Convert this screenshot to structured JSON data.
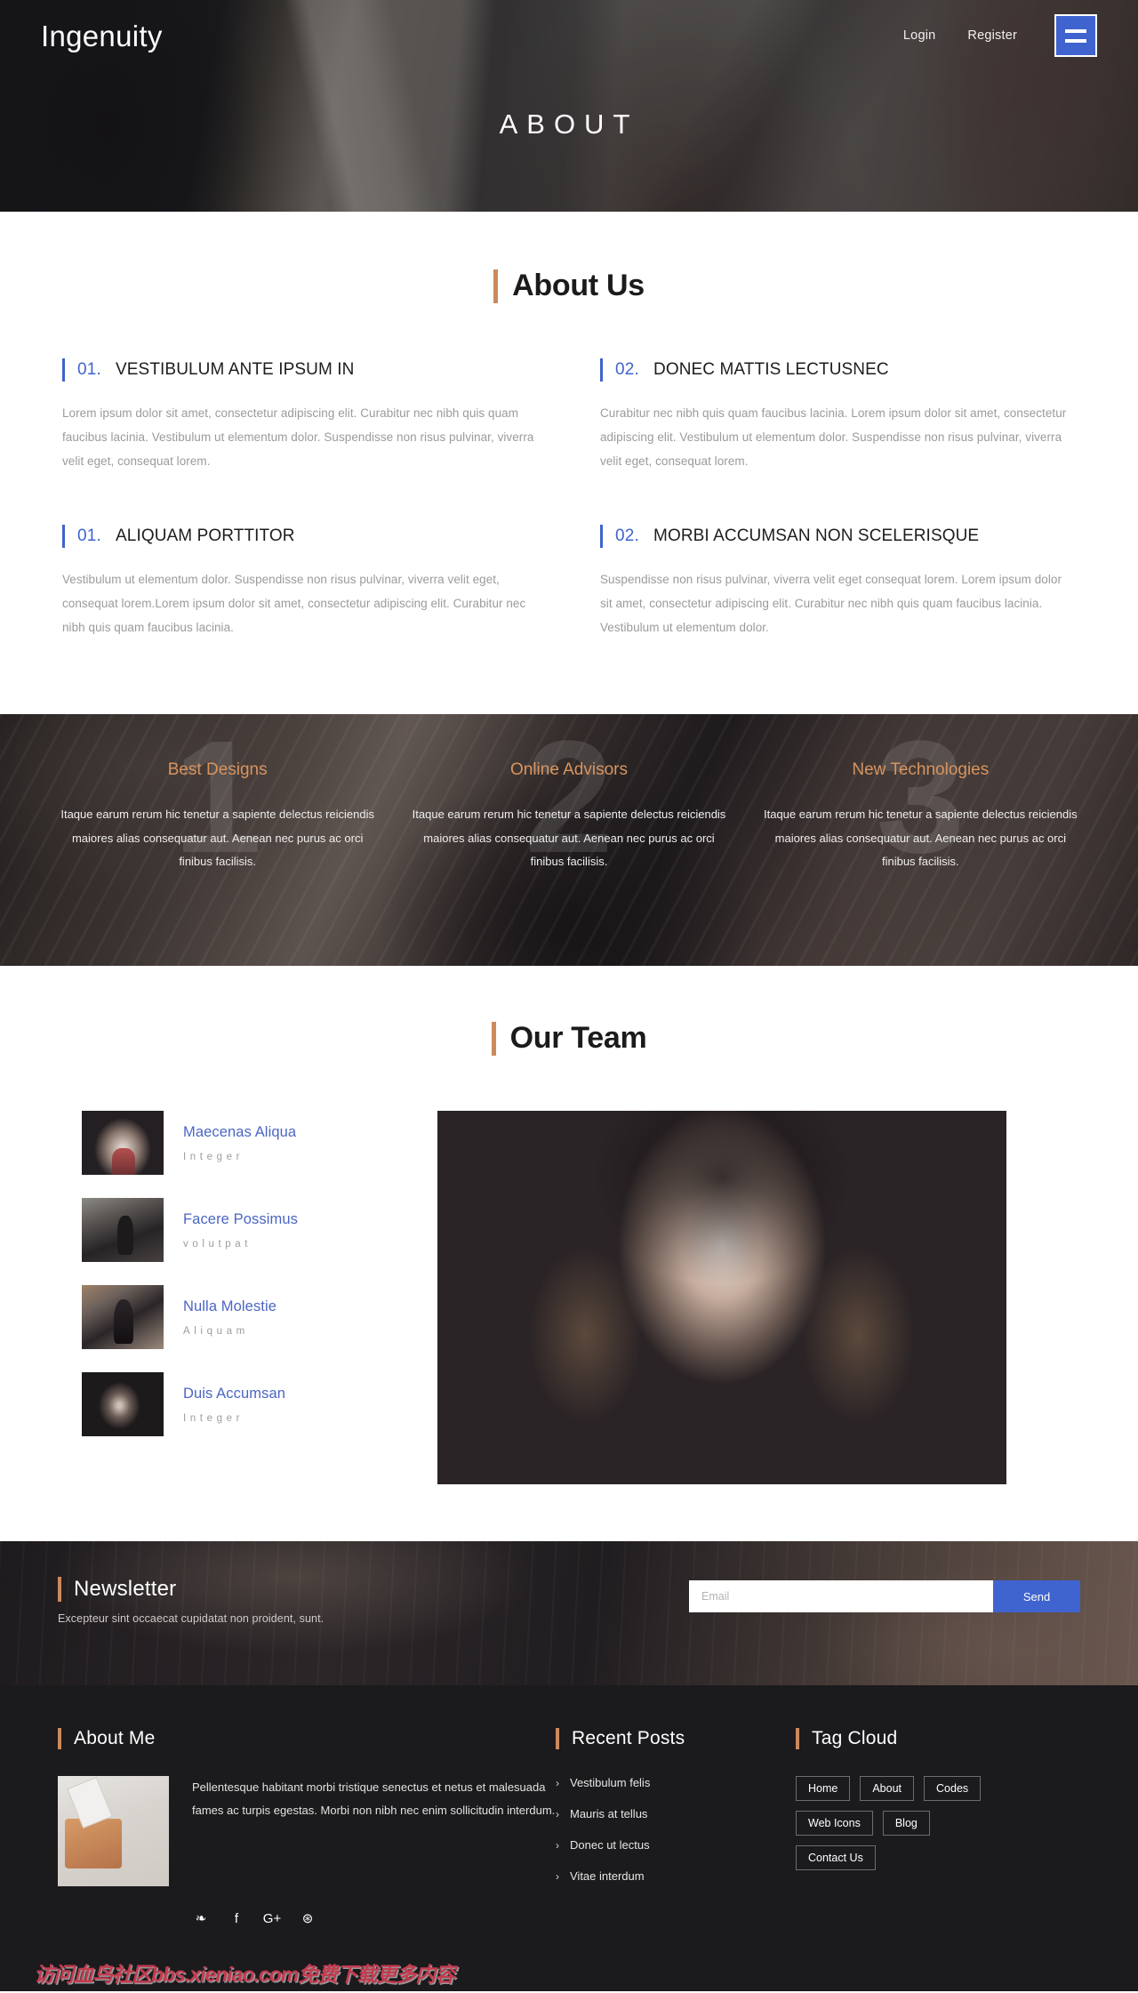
{
  "header": {
    "brand": "Ingenuity",
    "links": [
      {
        "label": "Login"
      },
      {
        "label": "Register"
      }
    ],
    "menu_icon": "hamburger-icon",
    "hero_title": "ABOUT",
    "accent_blue": "#3f63cf",
    "accent_orange": "#cc8a5c"
  },
  "about": {
    "section_title": "About Us",
    "features": [
      {
        "number": "01.",
        "title": "VESTIBULUM ANTE IPSUM IN",
        "body": "Lorem ipsum dolor sit amet, consectetur adipiscing elit. Curabitur nec nibh quis quam faucibus lacinia. Vestibulum ut elementum dolor. Suspendisse non risus pulvinar, viverra velit eget, consequat lorem."
      },
      {
        "number": "02.",
        "title": "DONEC MATTIS LECTUSNEC",
        "body": "Curabitur nec nibh quis quam faucibus lacinia. Lorem ipsum dolor sit amet, consectetur adipiscing elit. Vestibulum ut elementum dolor. Suspendisse non risus pulvinar, viverra velit eget, consequat lorem."
      },
      {
        "number": "01.",
        "title": "ALIQUAM PORTTITOR",
        "body": "Vestibulum ut elementum dolor. Suspendisse non risus pulvinar, viverra velit eget, consequat lorem.Lorem ipsum dolor sit amet, consectetur adipiscing elit. Curabitur nec nibh quis quam faucibus lacinia."
      },
      {
        "number": "02.",
        "title": "MORBI ACCUMSAN NON SCELERISQUE",
        "body": "Suspendisse non risus pulvinar, viverra velit eget consequat lorem. Lorem ipsum dolor sit amet, consectetur adipiscing elit. Curabitur nec nibh quis quam faucibus lacinia. Vestibulum ut elementum dolor."
      }
    ]
  },
  "services": [
    {
      "watermark": "1",
      "title": "Best Designs",
      "body": "Itaque earum rerum hic tenetur a sapiente delectus reiciendis maiores alias consequatur aut. Aenean nec purus ac orci finibus facilisis."
    },
    {
      "watermark": "2",
      "title": "Online Advisors",
      "body": "Itaque earum rerum hic tenetur a sapiente delectus reiciendis maiores alias consequatur aut. Aenean nec purus ac orci finibus facilisis."
    },
    {
      "watermark": "3",
      "title": "New Technologies",
      "body": "Itaque earum rerum hic tenetur a sapiente delectus reiciendis maiores alias consequatur aut. Aenean nec purus ac orci finibus facilisis."
    }
  ],
  "team": {
    "section_title": "Our Team",
    "members": [
      {
        "name": "Maecenas Aliqua",
        "role": "Integer"
      },
      {
        "name": "Facere Possimus",
        "role": "volutpat"
      },
      {
        "name": "Nulla Molestie",
        "role": "Aliquam"
      },
      {
        "name": "Duis Accumsan",
        "role": "Integer"
      }
    ],
    "feature_photo_alt": "team-feature-photo"
  },
  "newsletter": {
    "title": "Newsletter",
    "subtitle": "Excepteur sint occaecat cupidatat non proident, sunt.",
    "input_placeholder": "Email",
    "input_value": "",
    "button_label": "Send"
  },
  "footer": {
    "about": {
      "title": "About Me",
      "text": "Pellentesque habitant morbi tristique senectus et netus et malesuada fames ac turpis egestas. Morbi non nibh nec enim sollicitudin interdum.",
      "socials": [
        {
          "icon": "twitter-icon",
          "glyph": "❧"
        },
        {
          "icon": "facebook-icon",
          "glyph": "f"
        },
        {
          "icon": "google-plus-icon",
          "glyph": "G+"
        },
        {
          "icon": "dribbble-icon",
          "glyph": "⊛"
        }
      ]
    },
    "recent_posts": {
      "title": "Recent Posts",
      "items": [
        {
          "label": "Vestibulum felis"
        },
        {
          "label": "Mauris at tellus"
        },
        {
          "label": "Donec ut lectus"
        },
        {
          "label": "Vitae interdum"
        }
      ]
    },
    "tag_cloud": {
      "title": "Tag Cloud",
      "tags": [
        {
          "label": "Home"
        },
        {
          "label": "About"
        },
        {
          "label": "Codes"
        },
        {
          "label": "Web Icons"
        },
        {
          "label": "Blog"
        },
        {
          "label": "Contact Us"
        }
      ]
    },
    "watermark": "访问血鸟社区bbs.xieniao.com免费下载更多内容"
  }
}
